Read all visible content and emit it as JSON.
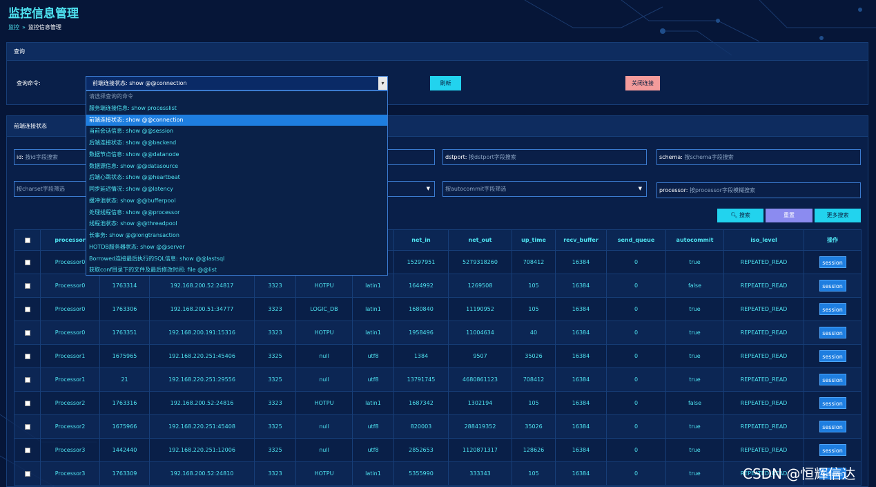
{
  "page": {
    "title": "监控信息管理",
    "breadcrumb": [
      "监控",
      "监控信息管理"
    ]
  },
  "query_panel": {
    "title": "查询",
    "label": "查询命令:",
    "selected": "前端连接状态:  show @@connection",
    "refresh_label": "刷新",
    "close_label": "关闭连接",
    "options": [
      "请选择查询的命令",
      "服务端连接信息:  show processlist",
      "前端连接状态:  show @@connection",
      "当前会话信息:  show @@session",
      "后端连接状态:  show @@backend",
      "数据节点信息:  show @@datanode",
      "数据源信息:  show @@datasource",
      "后端心跳状态:  show @@heartbeat",
      "同步延迟情况:  show @@latency",
      "缓冲池状态:  show @@bufferpool",
      "处理线程信息:  show @@processor",
      "线程池状态:  show @@threadpool",
      "长事务:  show @@longtransaction",
      "HOTDB服务器状态:  show @@server",
      "Borrowed连接最后执行的SQL信息:  show @@lastsql",
      "获取conf目录下的文件及最后修改时间:  file @@list"
    ]
  },
  "result_panel": {
    "title": "前端连接状态",
    "filters": {
      "id_label": "id:",
      "id_placeholder": "按id字段搜索",
      "dstport_label": "dstport:",
      "dstport_placeholder": "按dstport字段搜索",
      "schema_label": "schema:",
      "schema_placeholder": "按schema字段搜索",
      "charset_placeholder": "按charset字段筛选",
      "autocommit_placeholder": "按autocommit字段筛选",
      "processor_label": "processor:",
      "processor_placeholder": "按processor字段模糊搜索"
    },
    "search_label": "搜索",
    "reset_label": "重置",
    "more_label": "更多搜索",
    "columns": [
      "processor",
      "",
      "",
      "",
      "",
      "",
      "net_in",
      "net_out",
      "up_time",
      "recv_buffer",
      "send_queue",
      "autocommit",
      "iso_level",
      "操作"
    ],
    "rows": [
      [
        "Processor0",
        "",
        "",
        "",
        "",
        "",
        "15297951",
        "5279318260",
        "708412",
        "16384",
        "0",
        "true",
        "REPEATED_READ",
        "session"
      ],
      [
        "Processor0",
        "1763314",
        "192.168.200.52:24817",
        "3323",
        "HOTPU",
        "latin1",
        "1644992",
        "1269508",
        "105",
        "16384",
        "0",
        "false",
        "REPEATED_READ",
        "session"
      ],
      [
        "Processor0",
        "1763306",
        "192.168.200.51:34777",
        "3323",
        "LOGIC_DB",
        "latin1",
        "1680840",
        "11190952",
        "105",
        "16384",
        "0",
        "true",
        "REPEATED_READ",
        "session"
      ],
      [
        "Processor0",
        "1763351",
        "192.168.200.191:15316",
        "3323",
        "HOTPU",
        "latin1",
        "1958496",
        "11004634",
        "40",
        "16384",
        "0",
        "true",
        "REPEATED_READ",
        "session"
      ],
      [
        "Processor1",
        "1675965",
        "192.168.220.251:45406",
        "3325",
        "null",
        "utf8",
        "1384",
        "9507",
        "35026",
        "16384",
        "0",
        "true",
        "REPEATED_READ",
        "session"
      ],
      [
        "Processor1",
        "21",
        "192.168.220.251:29556",
        "3325",
        "null",
        "utf8",
        "13791745",
        "4680861123",
        "708412",
        "16384",
        "0",
        "true",
        "REPEATED_READ",
        "session"
      ],
      [
        "Processor2",
        "1763316",
        "192.168.200.52:24816",
        "3323",
        "HOTPU",
        "latin1",
        "1687342",
        "1302194",
        "105",
        "16384",
        "0",
        "false",
        "REPEATED_READ",
        "session"
      ],
      [
        "Processor2",
        "1675966",
        "192.168.220.251:45408",
        "3325",
        "null",
        "utf8",
        "820003",
        "288419352",
        "35026",
        "16384",
        "0",
        "true",
        "REPEATED_READ",
        "session"
      ],
      [
        "Processor3",
        "1442440",
        "192.168.220.251:12006",
        "3325",
        "null",
        "utf8",
        "2852653",
        "1120871317",
        "128626",
        "16384",
        "0",
        "true",
        "REPEATED_READ",
        "session"
      ],
      [
        "Processor3",
        "1763309",
        "192.168.200.52:24810",
        "3323",
        "HOTPU",
        "latin1",
        "5355990",
        "333343",
        "105",
        "16384",
        "0",
        "true",
        "REPEATED_READ",
        "session"
      ]
    ]
  },
  "watermark": "CSDN @恒辉信达",
  "colors": {
    "background": "#061638",
    "accent": "#4fe3f0",
    "primary_button": "#22d3ee",
    "danger_button": "#f49b9b",
    "reset_button": "#8b8bf0",
    "session_button": "#1e7ee0"
  }
}
